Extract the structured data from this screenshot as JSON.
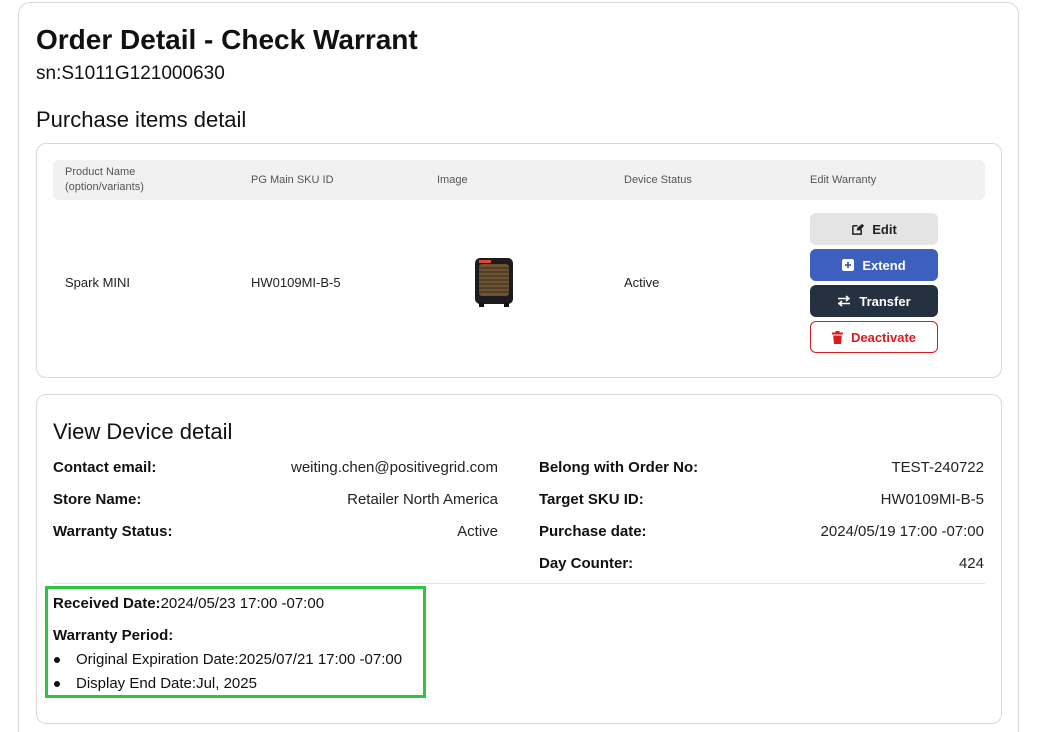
{
  "header": {
    "title": "Order Detail - Check Warrant",
    "serial": "sn:S1011G121000630",
    "section_title": "Purchase items detail"
  },
  "table": {
    "columns": {
      "product_line1": "Product Name",
      "product_line2": "(option/variants)",
      "sku": "PG Main SKU ID",
      "image": "Image",
      "status": "Device Status",
      "edit": "Edit Warranty"
    },
    "row": {
      "product": "Spark MINI",
      "sku": "HW0109MI-B-5",
      "status": "Active"
    },
    "buttons": {
      "edit": "Edit",
      "extend": "Extend",
      "transfer": "Transfer",
      "deactivate": "Deactivate"
    }
  },
  "device": {
    "title": "View Device detail",
    "contact_email_label": "Contact email:",
    "contact_email": "weiting.chen@positivegrid.com",
    "store_name_label": "Store Name:",
    "store_name": "Retailer North America",
    "warranty_status_label": "Warranty Status:",
    "warranty_status": "Active",
    "order_no_label": "Belong with Order No:",
    "order_no": "TEST-240722",
    "target_sku_label": "Target SKU ID:",
    "target_sku": "HW0109MI-B-5",
    "purchase_date_label": "Purchase date:",
    "purchase_date": "2024/05/19 17:00 -07:00",
    "day_counter_label": "Day Counter:",
    "day_counter": "424",
    "received_date_label": "Received Date:",
    "received_date": "2024/05/23 17:00 -07:00",
    "warranty_period_label": "Warranty Period:",
    "original_expiration_label": "Original Expiration Date:",
    "original_expiration": "2025/07/21 17:00 -07:00",
    "display_end_label": "Display End Date:",
    "display_end": "Jul, 2025"
  },
  "colors": {
    "extend_button": "#3d5fbd",
    "transfer_button": "#253040",
    "deactivate": "#d91b1b",
    "highlight_border": "#2fc440"
  },
  "icons": {
    "edit": "edit-icon",
    "extend": "plus-square-icon",
    "transfer": "swap-arrows-icon",
    "deactivate": "trash-icon"
  }
}
